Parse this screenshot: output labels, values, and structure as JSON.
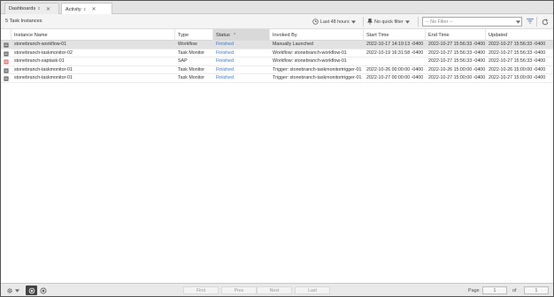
{
  "tabs": [
    {
      "label": "Dashboards",
      "pin": "⇕",
      "close": "✕"
    },
    {
      "label": "Activity",
      "pin": "⇕",
      "close": "✕"
    }
  ],
  "toolbar": {
    "count_label": "5 Task Instances",
    "time_range": "Last 48 hours",
    "quick_filter": "No quick filter",
    "filter_placeholder": "-- No Filter --"
  },
  "columns": [
    "Instance Name",
    "Type",
    "Status",
    "Invoked By",
    "Start Time",
    "End Time",
    "Updated"
  ],
  "sort_indicator": "^",
  "rows": [
    {
      "name": "stonebranch-workflow-01",
      "type": "Workflow",
      "status": "Finished",
      "invoked": "Manually Launched",
      "start": "2022-10-17 14:19:13 -0400",
      "end": "2022-10-27 15:56:33 -0400",
      "updated": "2022-10-27 15:56:33 -0400",
      "selected": true
    },
    {
      "name": "stonebranch-taskmonitor-02",
      "type": "Task Monitor",
      "status": "Finished",
      "invoked": "Workflow: stonebranch-workflow-01",
      "start": "2022-10-19 16:31:58 -0400",
      "end": "2022-10-27 15:56:33 -0400",
      "updated": "2022-10-27 15:56:33 -0400",
      "selected": false
    },
    {
      "name": "stonebranch-saptask-01",
      "type": "SAP",
      "status": "Finished",
      "invoked": "Workflow: stonebranch-workflow-01",
      "start": "",
      "end": "2022-10-27 15:56:33 -0400",
      "updated": "2022-10-27 15:56:33 -0400",
      "selected": false
    },
    {
      "name": "stonebranch-taskmonitor-01",
      "type": "Task Monitor",
      "status": "Finished",
      "invoked": "Trigger: stonebranch-taskmonitortrigger-01",
      "start": "2022-10-26 00:00:00 -0400",
      "end": "2022-10-26 15:00:00 -0400",
      "updated": "2022-10-26 15:00:00 -0400",
      "selected": false
    },
    {
      "name": "stonebranch-taskmonitor-01",
      "type": "Task Monitor",
      "status": "Finished",
      "invoked": "Trigger: stonebranch-taskmonitortrigger-01",
      "start": "2022-10-27 00:00:00 -0400",
      "end": "2022-10-27 15:00:00 -0400",
      "updated": "2022-10-27 15:00:00 -0400",
      "selected": false
    }
  ],
  "footer": {
    "first": "First",
    "prev": "Prev",
    "next": "Next",
    "last": "Last",
    "page_label": "Page",
    "page_value": "1",
    "of_label": "of",
    "total_pages": "1"
  },
  "colors": {
    "status_finished": "#3c78c8",
    "selected_row": "#e2e2e2",
    "sorted_header": "#d9d9d9",
    "sap_icon": "#e07a7a"
  },
  "icons": {
    "time_range": "clock-icon",
    "quick_filter": "pin-icon",
    "filter": "funnel-icon",
    "refresh": "refresh-icon",
    "row_types": [
      "workflow-icon",
      "taskmonitor-icon",
      "sap-icon",
      "taskmonitor-icon",
      "taskmonitor-icon"
    ]
  }
}
